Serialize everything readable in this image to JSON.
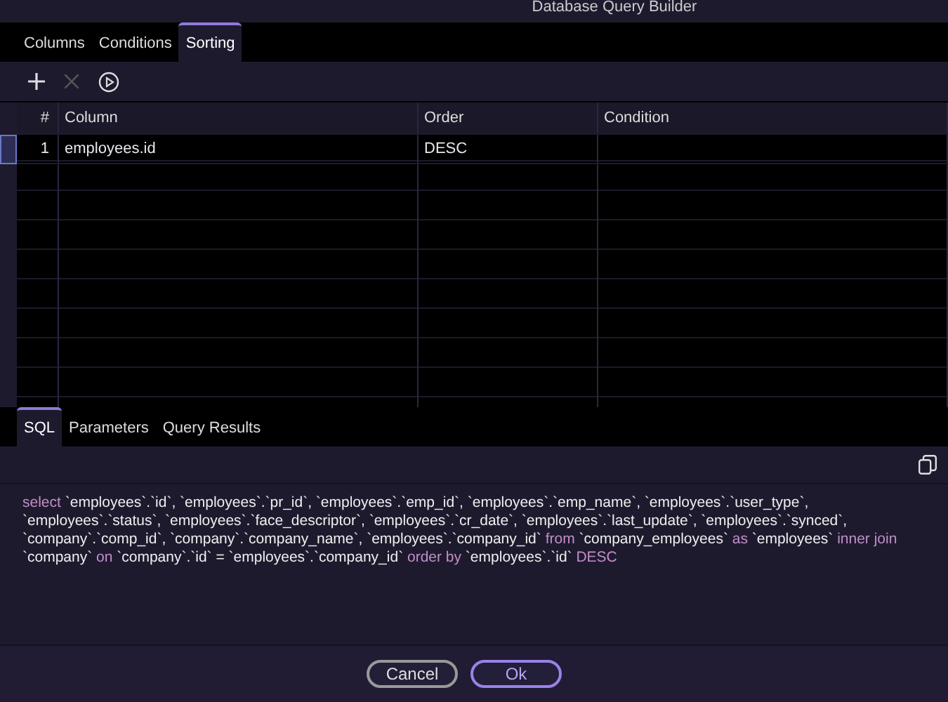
{
  "window": {
    "title": "Database Query Builder"
  },
  "tabs": [
    {
      "label": "Columns",
      "selected": false
    },
    {
      "label": "Conditions",
      "selected": false
    },
    {
      "label": "Sorting",
      "selected": true
    }
  ],
  "toolbar": {
    "remove_disabled": true
  },
  "table": {
    "columns": [
      "#",
      "Column",
      "Order",
      "Condition"
    ],
    "rows": [
      {
        "cells": [
          "1",
          "employees.id",
          "DESC",
          ""
        ],
        "selected": true
      }
    ]
  },
  "bottom_tabs": [
    {
      "label": "SQL",
      "selected": true
    },
    {
      "label": "Parameters",
      "selected": false
    },
    {
      "label": "Query Results",
      "selected": false
    }
  ],
  "sql": [
    {
      "kind": "keyword",
      "text": "select"
    },
    {
      "kind": "text",
      "text": " `employees`.`id`, `employees`.`pr_id`, `employees`.`emp_id`, `employees`.`emp_name`, `employees`.`user_type`, `employees`.`status`, `employees`.`face_descriptor`, `employees`.`cr_date`, `employees`.`last_update`, `employees`.`synced`, `company`.`comp_id`, `company`.`company_name`, `employees`.`company_id` "
    },
    {
      "kind": "keyword",
      "text": "from"
    },
    {
      "kind": "text",
      "text": " `company_employees` "
    },
    {
      "kind": "keyword",
      "text": "as"
    },
    {
      "kind": "text",
      "text": " `employees` "
    },
    {
      "kind": "keyword",
      "text": "inner join"
    },
    {
      "kind": "text",
      "text": " `company` "
    },
    {
      "kind": "keyword",
      "text": "on"
    },
    {
      "kind": "text",
      "text": " `company`.`id` = `employees`.`company_id` "
    },
    {
      "kind": "keyword",
      "text": "order by"
    },
    {
      "kind": "text",
      "text": " `employees`.`id` "
    },
    {
      "kind": "keyword",
      "text": "DESC"
    }
  ],
  "buttons": [
    {
      "label": "Cancel",
      "kind": "secondary"
    },
    {
      "label": "Ok",
      "kind": "primary"
    }
  ]
}
